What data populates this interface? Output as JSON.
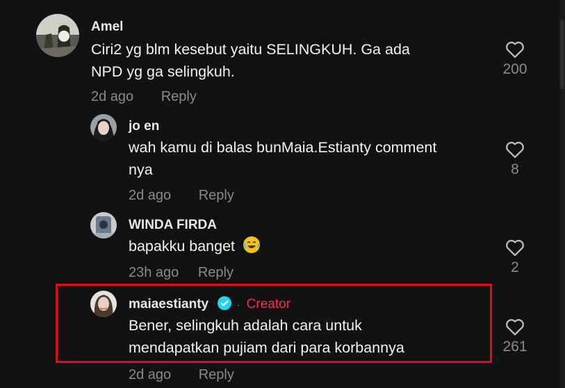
{
  "comments": [
    {
      "username": "Amel",
      "text_line1": "Ciri2 yg blm kesebut yaitu SELINGKUH. Ga ada",
      "text_line2": "NPD yg ga selingkuh.",
      "time": "2d ago",
      "reply_label": "Reply",
      "likes": "200"
    },
    {
      "username": "jo en",
      "text_line1": "wah kamu di balas bunMaia.Estianty comment",
      "text_line2": "nya",
      "time": "2d ago",
      "reply_label": "Reply",
      "likes": "8"
    },
    {
      "username": "WINDA FIRDA",
      "text_line1": "bapakku banget",
      "emoji": "rolling-on-floor-laughing",
      "time": "23h ago",
      "reply_label": "Reply",
      "likes": "2"
    },
    {
      "username": "maiaestianty",
      "verified": true,
      "creator_label": "Creator",
      "text_line1": "Bener, selingkuh adalah cara untuk",
      "text_line2": "mendapatkan pujiam dari para korbannya",
      "time": "2d ago",
      "reply_label": "Reply",
      "likes": "261"
    }
  ],
  "icons": {
    "like": "heart-outline-icon",
    "verified": "verified-badge-icon"
  },
  "colors": {
    "background": "#121212",
    "creator": "#fe2c55",
    "verified": "#20d5ec",
    "highlight_border": "#d9101b",
    "muted": "#8a8a8a"
  }
}
